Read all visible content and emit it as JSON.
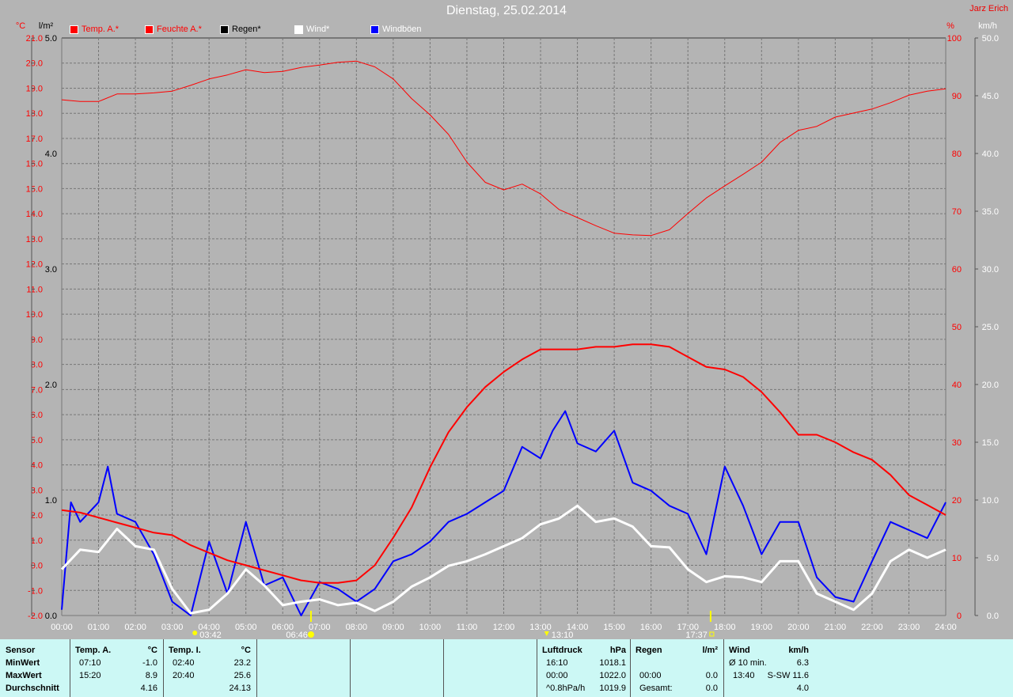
{
  "title": "Dienstag, 25.02.2014",
  "author": "Jarz Erich",
  "legend": [
    {
      "label": "Temp. A.*",
      "color": "#ff0000",
      "text_color": "#ff0000"
    },
    {
      "label": "Feuchte A.*",
      "color": "#ff0000",
      "text_color": "#ff0000"
    },
    {
      "label": "Regen*",
      "color": "#000000",
      "text_color": "#000000"
    },
    {
      "label": "Wind*",
      "color": "#ffffff",
      "text_color": "#ffffff"
    },
    {
      "label": "Windböen",
      "color": "#0000ff",
      "text_color": "#ffffff"
    }
  ],
  "axes": {
    "temp_unit": "°C",
    "rain_unit": "l/m²",
    "hum_unit": "%",
    "wind_unit": "km/h"
  },
  "astro": {
    "moonrise": "03:42",
    "sunrise": "06:46",
    "moonset": "13:10",
    "sunset": "17:37"
  },
  "chart_data": {
    "type": "line",
    "x_ticks": [
      "00:00",
      "01:00",
      "02:00",
      "03:00",
      "04:00",
      "05:00",
      "06:00",
      "07:00",
      "08:00",
      "09:00",
      "10:00",
      "11:00",
      "12:00",
      "13:00",
      "14:00",
      "15:00",
      "16:00",
      "17:00",
      "18:00",
      "19:00",
      "20:00",
      "21:00",
      "22:00",
      "23:00",
      "24:00"
    ],
    "temp_axis": {
      "range": [
        -2.0,
        21.0
      ],
      "ticks": [
        -2.0,
        -1.0,
        0.0,
        1.0,
        2.0,
        3.0,
        4.0,
        5.0,
        6.0,
        7.0,
        8.0,
        9.0,
        10.0,
        11.0,
        12.0,
        13.0,
        14.0,
        15.0,
        16.0,
        17.0,
        18.0,
        19.0,
        20.0,
        21.0
      ]
    },
    "rain_axis": {
      "range": [
        0,
        5
      ],
      "ticks": [
        0.0,
        1.0,
        2.0,
        3.0,
        4.0,
        5.0
      ]
    },
    "hum_axis": {
      "range": [
        0,
        100
      ],
      "ticks": [
        0,
        10,
        20,
        30,
        40,
        50,
        60,
        70,
        80,
        90,
        100
      ]
    },
    "wind_axis": {
      "range": [
        0,
        50
      ],
      "ticks": [
        0.0,
        5.0,
        10.0,
        15.0,
        20.0,
        25.0,
        30.0,
        35.0,
        40.0,
        45.0,
        50.0
      ]
    },
    "grid": true,
    "series": [
      {
        "name": "Feuchte A.*",
        "axis": "hum",
        "color": "#ff0000",
        "x": [
          0,
          0.5,
          1,
          1.5,
          2,
          2.5,
          3,
          3.5,
          4,
          4.5,
          5,
          5.5,
          6,
          6.5,
          7,
          7.5,
          8,
          8.5,
          9,
          9.5,
          10,
          10.5,
          11,
          11.5,
          12,
          12.5,
          13,
          13.5,
          14,
          14.5,
          15,
          15.5,
          16,
          16.5,
          17,
          17.5,
          18,
          18.5,
          19,
          19.5,
          20,
          20.5,
          21,
          21.5,
          22,
          22.5,
          23,
          23.5,
          24
        ],
        "values": [
          89.3,
          89,
          89,
          90.3,
          90.3,
          90.5,
          90.8,
          91.8,
          92.9,
          93.6,
          94.5,
          94,
          94.2,
          94.9,
          95.3,
          95.8,
          96,
          95,
          92.9,
          89.5,
          86.7,
          83.3,
          78.5,
          75,
          73.7,
          74.7,
          73,
          70.3,
          68.9,
          67.5,
          66.2,
          65.9,
          65.8,
          66.8,
          69.6,
          72.3,
          74.4,
          76.4,
          78.5,
          81.9,
          84,
          84.7,
          86.3,
          87,
          87.7,
          88.8,
          90.1,
          90.8,
          91.2
        ]
      },
      {
        "name": "Temp. A.*",
        "axis": "temp",
        "color": "#ff0000",
        "x": [
          0,
          0.5,
          1,
          1.5,
          2,
          2.5,
          3,
          3.5,
          4,
          4.5,
          5,
          5.5,
          6,
          6.5,
          7,
          7.5,
          8,
          8.5,
          9,
          9.5,
          10,
          10.5,
          11,
          11.5,
          12,
          12.5,
          13,
          13.5,
          14,
          14.5,
          15,
          15.5,
          16,
          16.5,
          17,
          17.5,
          18,
          18.5,
          19,
          19.5,
          20,
          20.5,
          21,
          21.5,
          22,
          22.5,
          23,
          23.5,
          24
        ],
        "values": [
          2.2,
          2.1,
          1.9,
          1.7,
          1.5,
          1.3,
          1.2,
          0.8,
          0.5,
          0.2,
          0.0,
          -0.2,
          -0.4,
          -0.6,
          -0.7,
          -0.7,
          -0.6,
          0.0,
          1.1,
          2.3,
          3.9,
          5.3,
          6.3,
          7.1,
          7.7,
          8.2,
          8.6,
          8.6,
          8.6,
          8.7,
          8.7,
          8.8,
          8.8,
          8.7,
          8.3,
          7.9,
          7.8,
          7.5,
          6.9,
          6.1,
          5.2,
          5.2,
          4.9,
          4.5,
          4.2,
          3.6,
          2.8,
          2.4,
          2.0
        ]
      },
      {
        "name": "Wind*",
        "axis": "wind",
        "color": "#ffffff",
        "x": [
          0,
          0.5,
          1,
          1.5,
          2,
          2.5,
          3,
          3.5,
          4,
          4.5,
          5,
          5.5,
          6,
          6.5,
          7,
          7.5,
          8,
          8.5,
          9,
          9.5,
          10,
          10.5,
          11,
          11.5,
          12,
          12.5,
          13,
          13.5,
          14,
          14.5,
          15,
          15.5,
          16,
          16.5,
          17,
          17.5,
          18,
          18.5,
          19,
          19.5,
          20,
          20.5,
          21,
          21.5,
          22,
          22.5,
          23,
          23.5,
          24
        ],
        "values": [
          4.0,
          5.7,
          5.5,
          7.5,
          6.0,
          5.7,
          2.3,
          0.2,
          0.5,
          1.9,
          4.0,
          2.6,
          0.9,
          1.2,
          1.4,
          0.9,
          1.1,
          0.4,
          1.2,
          2.5,
          3.3,
          4.3,
          4.7,
          5.3,
          6.0,
          6.7,
          7.9,
          8.4,
          9.5,
          8.1,
          8.4,
          7.7,
          6.0,
          5.9,
          4.0,
          2.9,
          3.4,
          3.3,
          2.9,
          4.7,
          4.7,
          1.9,
          1.2,
          0.5,
          1.9,
          4.7,
          5.7,
          5.0,
          5.7
        ]
      },
      {
        "name": "Windböen",
        "axis": "wind",
        "color": "#0000ff",
        "x": [
          0,
          0.25,
          0.5,
          1,
          1.25,
          1.5,
          2,
          2.5,
          3,
          3.5,
          4,
          4.5,
          5,
          5.5,
          6,
          6.5,
          7,
          7.5,
          8,
          8.5,
          9,
          9.5,
          10,
          10.5,
          11,
          11.5,
          12,
          12.5,
          13,
          13.33,
          13.67,
          14,
          14.5,
          15,
          15.5,
          16,
          16.5,
          17,
          17.5,
          18,
          18.5,
          19,
          19.5,
          20,
          20.5,
          21,
          21.5,
          22,
          22.5,
          23,
          23.5,
          24
        ],
        "values": [
          0.5,
          9.8,
          8.1,
          9.8,
          12.9,
          8.8,
          8.1,
          5.3,
          1.2,
          0,
          6.4,
          1.9,
          8.1,
          2.6,
          3.3,
          0,
          2.9,
          2.3,
          1.2,
          2.3,
          4.7,
          5.3,
          6.4,
          8.1,
          8.8,
          9.8,
          10.8,
          14.6,
          13.6,
          16.0,
          17.7,
          14.9,
          14.2,
          16.0,
          11.5,
          10.8,
          9.5,
          8.8,
          5.3,
          12.9,
          9.5,
          5.3,
          8.1,
          8.1,
          3.3,
          1.6,
          1.2,
          4.7,
          8.1,
          7.4,
          6.7,
          9.8
        ]
      }
    ]
  },
  "table": {
    "temp_a": {
      "header": "Sensor",
      "title": "Temp. A.",
      "unit": "°C",
      "rows": [
        "MinWert",
        "MaxWert",
        "Durchschnitt"
      ],
      "times": [
        "07:10",
        "15:20",
        ""
      ],
      "values": [
        "-1.0",
        "8.9",
        "4.16"
      ]
    },
    "temp_i": {
      "title": "Temp. I.",
      "unit": "°C",
      "times": [
        "02:40",
        "20:40",
        ""
      ],
      "values": [
        "23.2",
        "25.6",
        "24.13"
      ]
    },
    "pressure": {
      "title": "Luftdruck",
      "unit": "hPa",
      "times": [
        "16:10",
        "00:00",
        "^0.8hPa/h"
      ],
      "values": [
        "1018.1",
        "1022.0",
        "1019.9"
      ]
    },
    "rain": {
      "title": "Regen",
      "unit": "l/m²",
      "times": [
        "",
        "00:00",
        "Gesamt:"
      ],
      "values": [
        "",
        "0.0",
        "0.0"
      ]
    },
    "wind": {
      "title": "Wind",
      "unit": "km/h",
      "times": [
        "Ø 10 min.",
        "13:40",
        ""
      ],
      "values": [
        "6.3",
        "S-SW 11.6",
        "4.0"
      ]
    }
  }
}
